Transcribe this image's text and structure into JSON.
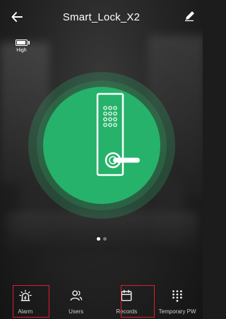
{
  "header": {
    "title": "Smart_Lock_X2"
  },
  "battery": {
    "level_label": "High",
    "level_fraction": 0.8
  },
  "lock": {
    "state": "locked",
    "icon": "door-lock-icon"
  },
  "pager": {
    "pages": 2,
    "current": 1
  },
  "bottom_nav": [
    {
      "label": "Alarm",
      "icon": "alarm-siren-icon",
      "highlighted": true
    },
    {
      "label": "Users",
      "icon": "users-icon",
      "highlighted": false
    },
    {
      "label": "Records",
      "icon": "calendar-icon",
      "highlighted": true
    },
    {
      "label": "Temporary PW",
      "icon": "keypad-grid-icon",
      "highlighted": false
    }
  ],
  "colors": {
    "accent_green": "#26b26a",
    "highlight_red": "#e21b2d"
  }
}
